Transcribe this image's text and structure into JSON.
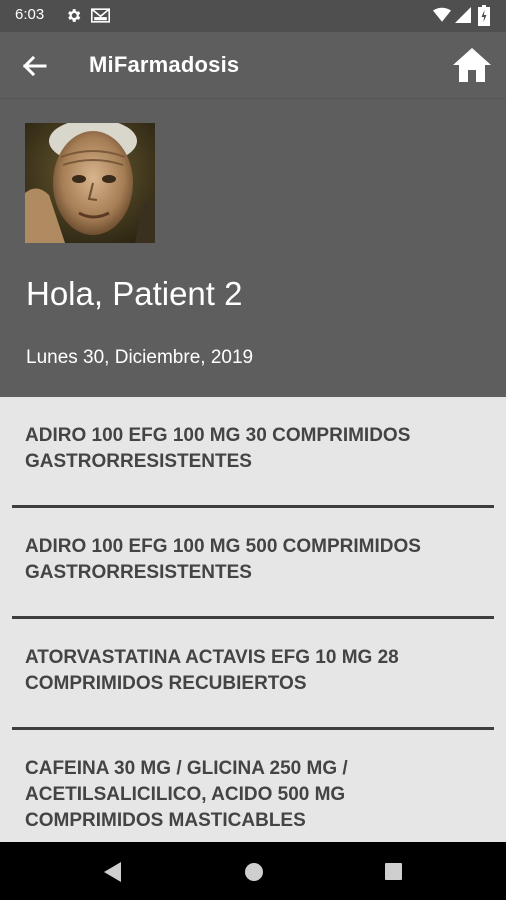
{
  "status_bar": {
    "time": "6:03",
    "icons": [
      "gear-icon",
      "mail-icon",
      "wifi-icon",
      "cell-signal-icon",
      "battery-icon"
    ]
  },
  "app_bar": {
    "title": "MiFarmadosis",
    "back_icon": "arrow-left-icon",
    "home_icon": "home-icon"
  },
  "header": {
    "greeting": "Hola, Patient 2",
    "date": "Lunes 30, Diciembre, 2019"
  },
  "medications": [
    {
      "name": "ADIRO 100 EFG 100 MG 30 COMPRIMIDOS GASTRORRESISTENTES"
    },
    {
      "name": "ADIRO 100 EFG 100 MG 500 COMPRIMIDOS GASTRORRESISTENTES"
    },
    {
      "name": "ATORVASTATINA ACTAVIS EFG 10 MG 28 COMPRIMIDOS RECUBIERTOS"
    },
    {
      "name": "CAFEINA 30 MG / GLICINA 250 MG / ACETILSALICILICO, ACIDO 500 MG COMPRIMIDOS MASTICABLES"
    }
  ],
  "nav_bar": {
    "icons": [
      "nav-back-icon",
      "nav-home-icon",
      "nav-recents-icon"
    ]
  },
  "colors": {
    "header_bg": "#5e5e5e",
    "status_bg": "#4f4f4f",
    "list_bg": "#e6e6e6",
    "list_text": "#444444",
    "divider": "#3e3e3e"
  }
}
